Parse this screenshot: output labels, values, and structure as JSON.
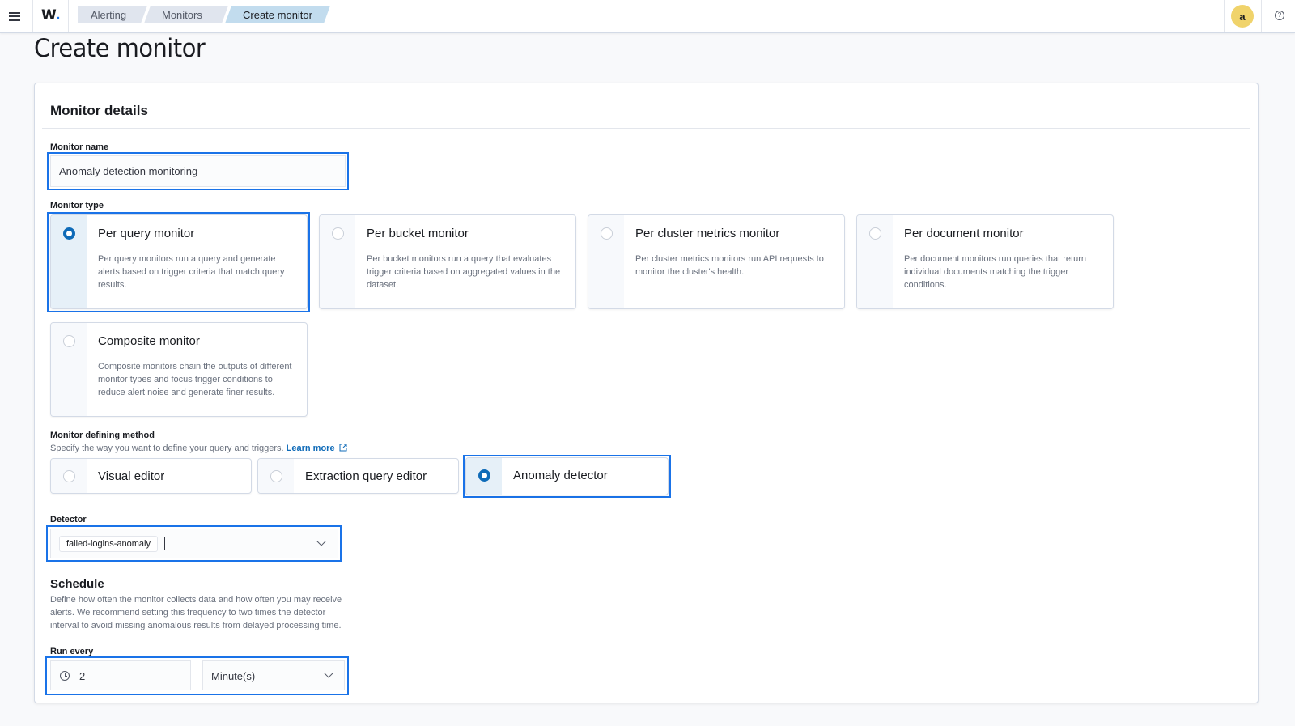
{
  "header": {
    "logo_text": "W",
    "logo_dot": ".",
    "breadcrumbs": [
      {
        "label": "Alerting"
      },
      {
        "label": "Monitors"
      },
      {
        "label": "Create monitor"
      }
    ],
    "avatar_initial": "a",
    "help_glyph": "?"
  },
  "page": {
    "title": "Create monitor"
  },
  "monitor_details": {
    "section_title": "Monitor details",
    "monitor_name": {
      "label": "Monitor name",
      "value": "Anomaly detection monitoring"
    },
    "monitor_type": {
      "label": "Monitor type",
      "selected": "Per query monitor",
      "options": [
        {
          "title": "Per query monitor",
          "description": "Per query monitors run a query and generate alerts based on trigger criteria that match query results.",
          "selected": true
        },
        {
          "title": "Per bucket monitor",
          "description": "Per bucket monitors run a query that evaluates trigger criteria based on aggregated values in the dataset.",
          "selected": false
        },
        {
          "title": "Per cluster metrics monitor",
          "description": "Per cluster metrics monitors run API requests to monitor the cluster's health.",
          "selected": false
        },
        {
          "title": "Per document monitor",
          "description": "Per document monitors run queries that return individual documents matching the trigger conditions.",
          "selected": false
        },
        {
          "title": "Composite monitor",
          "description": "Composite monitors chain the outputs of different monitor types and focus trigger conditions to reduce alert noise and generate finer results.",
          "selected": false
        }
      ]
    },
    "defining_method": {
      "label": "Monitor defining method",
      "helper": "Specify the way you want to define your query and triggers.",
      "learn_more": "Learn more",
      "options": [
        {
          "label": "Visual editor",
          "selected": false
        },
        {
          "label": "Extraction query editor",
          "selected": false
        },
        {
          "label": "Anomaly detector",
          "selected": true
        }
      ]
    },
    "detector": {
      "label": "Detector",
      "selected_value": "failed-logins-anomaly"
    },
    "schedule": {
      "title": "Schedule",
      "description": "Define how often the monitor collects data and how often you may receive alerts. We recommend setting this frequency to two times the detector interval to avoid missing anomalous results from delayed processing time.",
      "run_every_label": "Run every",
      "interval_value": "2",
      "unit_value": "Minute(s)"
    }
  },
  "colors": {
    "accent": "#1a73e8",
    "radio_selected": "#0f6bb8",
    "avatar": "#f0d36b",
    "breadcrumb_active": "#c2dcee"
  }
}
